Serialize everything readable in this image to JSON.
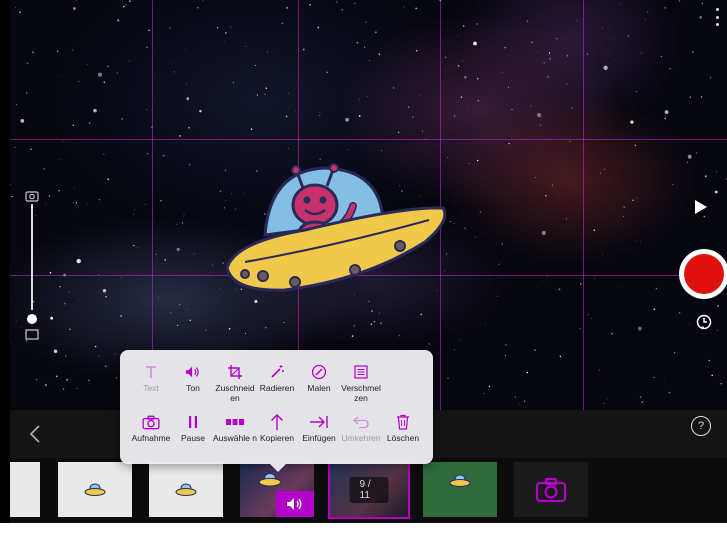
{
  "colors": {
    "accent": "#b400c8",
    "record": "#e01010",
    "menu_bg": "#ebebf0",
    "grid": "#c828dc"
  },
  "edit_menu": {
    "row1": [
      {
        "id": "text",
        "label": "Text",
        "icon": "text-icon",
        "enabled": false
      },
      {
        "id": "ton",
        "label": "Ton",
        "icon": "speaker-icon",
        "enabled": true
      },
      {
        "id": "zuschneiden",
        "label": "Zuschneid en",
        "icon": "crop-icon",
        "enabled": true
      },
      {
        "id": "radieren",
        "label": "Radieren",
        "icon": "magic-wand-icon",
        "enabled": true
      },
      {
        "id": "malen",
        "label": "Malen",
        "icon": "paint-icon",
        "enabled": true
      },
      {
        "id": "verschmelzen",
        "label": "Verschmel zen",
        "icon": "merge-icon",
        "enabled": true
      }
    ],
    "row2": [
      {
        "id": "aufnahme",
        "label": "Aufnahme",
        "icon": "camera-icon",
        "enabled": true
      },
      {
        "id": "pause",
        "label": "Pause",
        "icon": "pause-icon",
        "enabled": true
      },
      {
        "id": "auswaehlen",
        "label": "Auswähle n",
        "icon": "select-icon",
        "enabled": true
      },
      {
        "id": "kopieren",
        "label": "Kopieren",
        "icon": "arrow-up-icon",
        "enabled": true
      },
      {
        "id": "einfuegen",
        "label": "Einfügen",
        "icon": "insert-icon",
        "enabled": true
      },
      {
        "id": "umkehren",
        "label": "Umkehren",
        "icon": "undo-icon",
        "enabled": false
      },
      {
        "id": "loeschen",
        "label": "Löschen",
        "icon": "trash-icon",
        "enabled": true
      }
    ]
  },
  "timeline": {
    "selected_counter": "9 / 11"
  },
  "toolbar": {
    "help_label": "?"
  }
}
